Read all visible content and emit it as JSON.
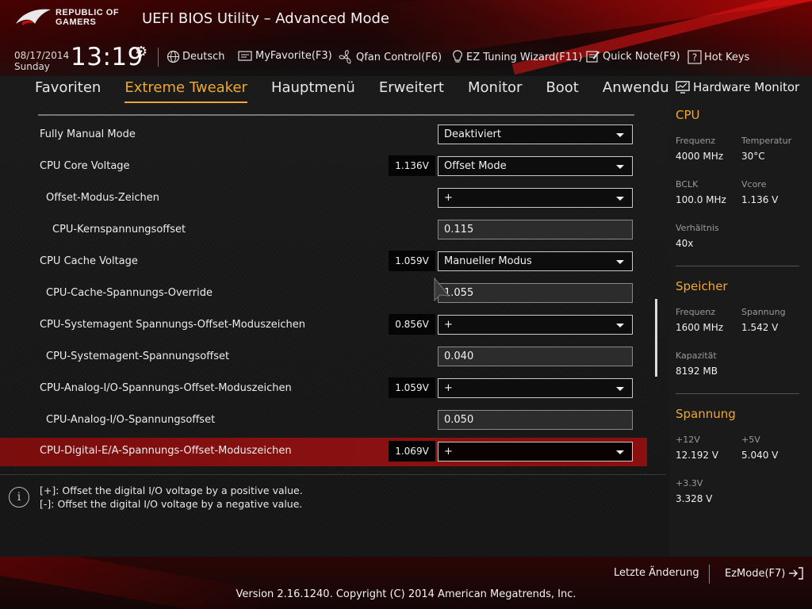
{
  "header": {
    "brand_line1": "REPUBLIC OF",
    "brand_line2": "GAMERS",
    "title": "UEFI BIOS Utility – Advanced Mode",
    "date": "08/17/2014",
    "day": "Sunday",
    "time": "13:19",
    "tools": [
      {
        "label": "Deutsch",
        "icon": "globe-icon"
      },
      {
        "label": "MyFavorite(F3)",
        "icon": "favorite-icon"
      },
      {
        "label": "Qfan Control(F6)",
        "icon": "fan-icon"
      },
      {
        "label": "EZ Tuning Wizard(F11)",
        "icon": "lightbulb-icon"
      },
      {
        "label": "Quick Note(F9)",
        "icon": "note-icon"
      },
      {
        "label": "Hot Keys",
        "icon": "question-icon"
      }
    ]
  },
  "tabs": [
    {
      "label": "Favoriten",
      "active": false
    },
    {
      "label": "Extreme Tweaker",
      "active": true
    },
    {
      "label": "Hauptmenü",
      "active": false
    },
    {
      "label": "Erweitert",
      "active": false
    },
    {
      "label": "Monitor",
      "active": false
    },
    {
      "label": "Boot",
      "active": false
    },
    {
      "label": "Anwendu",
      "active": false
    }
  ],
  "settings": [
    {
      "label": "Fully Manual Mode",
      "voltage": "",
      "control": "dropdown",
      "value": "Deaktiviert"
    },
    {
      "label": "CPU Core Voltage",
      "voltage": "1.136V",
      "control": "dropdown",
      "value": "Offset Mode"
    },
    {
      "label": "Offset-Modus-Zeichen",
      "voltage": "",
      "control": "dropdown",
      "value": "+"
    },
    {
      "label": "CPU-Kernspannungsoffset",
      "voltage": "",
      "control": "field",
      "value": "0.115"
    },
    {
      "label": "CPU Cache Voltage",
      "voltage": "1.059V",
      "control": "dropdown",
      "value": "Manueller Modus"
    },
    {
      "label": "CPU-Cache-Spannungs-Override",
      "voltage": "",
      "control": "field",
      "value": "1.055"
    },
    {
      "label": "CPU-Systemagent Spannungs-Offset-Moduszeichen",
      "voltage": "0.856V",
      "control": "dropdown",
      "value": "+"
    },
    {
      "label": "CPU-Systemagent-Spannungsoffset",
      "voltage": "",
      "control": "field",
      "value": "0.040"
    },
    {
      "label": "CPU-Analog-I/O-Spannungs-Offset-Moduszeichen",
      "voltage": "1.059V",
      "control": "dropdown",
      "value": "+"
    },
    {
      "label": "CPU-Analog-I/O-Spannungsoffset",
      "voltage": "",
      "control": "field",
      "value": "0.050"
    },
    {
      "label": "CPU-Digital-E/A-Spannungs-Offset-Moduszeichen",
      "voltage": "1.069V",
      "control": "dropdown",
      "value": "+",
      "selected": true
    }
  ],
  "info": {
    "line1": "[+]: Offset the digital I/O voltage by a positive value.",
    "line2": "[-]: Offset the digital I/O voltage by a negative value."
  },
  "hardware_monitor": {
    "title": "Hardware Monitor",
    "cpu": {
      "heading": "CPU",
      "freq_label": "Frequenz",
      "freq_value": "4000 MHz",
      "temp_label": "Temperatur",
      "temp_value": "30°C",
      "bclk_label": "BCLK",
      "bclk_value": "100.0 MHz",
      "vcore_label": "Vcore",
      "vcore_value": "1.136 V",
      "ratio_label": "Verhältnis",
      "ratio_value": "40x"
    },
    "memory": {
      "heading": "Speicher",
      "freq_label": "Frequenz",
      "freq_value": "1600 MHz",
      "volt_label": "Spannung",
      "volt_value": "1.542 V",
      "cap_label": "Kapazität",
      "cap_value": "8192 MB"
    },
    "voltage": {
      "heading": "Spannung",
      "v12_label": "+12V",
      "v12_value": "12.192 V",
      "v5_label": "+5V",
      "v5_value": "5.040 V",
      "v33_label": "+3.3V",
      "v33_value": "3.328 V"
    }
  },
  "footer": {
    "last_change": "Letzte Änderung",
    "ezmode": "EzMode(F7)",
    "copyright": "Version 2.16.1240. Copyright (C) 2014 American Megatrends, Inc."
  },
  "colors": {
    "accent": "#f0a830",
    "selected_row": "#8b1111",
    "brand_red": "#d01010"
  }
}
